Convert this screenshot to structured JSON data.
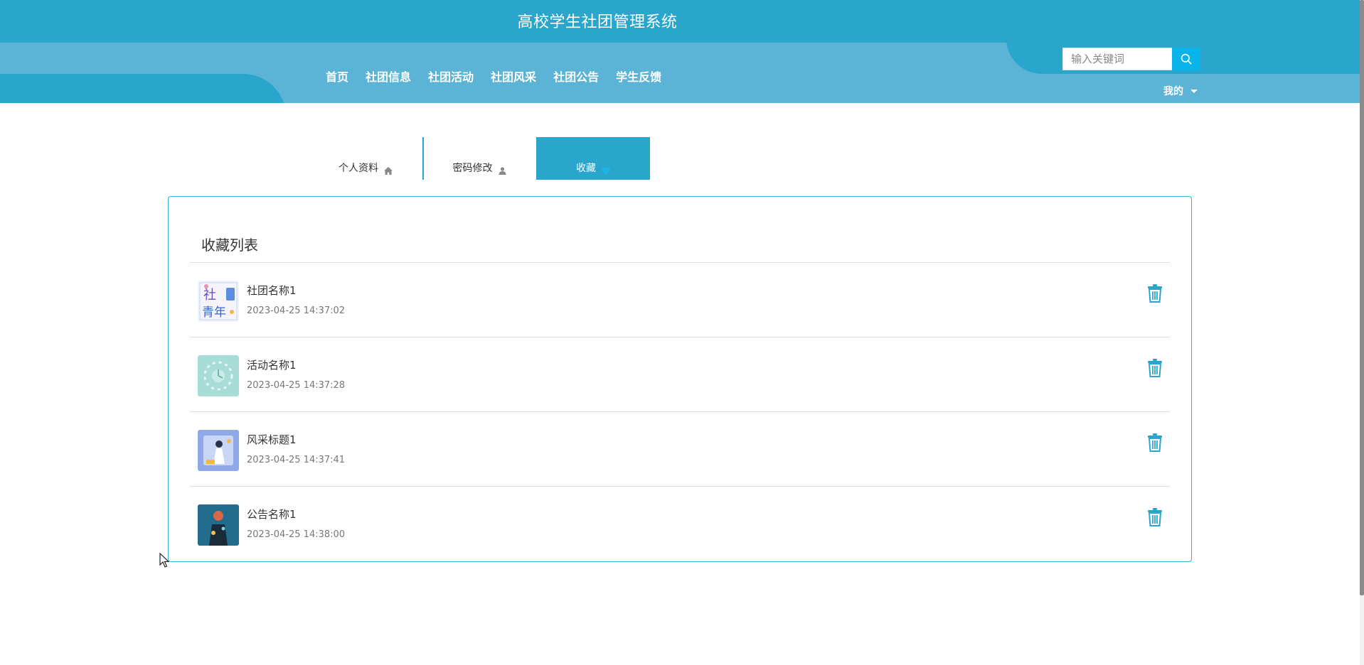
{
  "header": {
    "title": "高校学生社团管理系统",
    "nav": [
      "首页",
      "社团信息",
      "社团活动",
      "社团风采",
      "社团公告",
      "学生反馈"
    ],
    "search_placeholder": "输入关键词",
    "search_icon": "search-icon",
    "mine_label": "我的"
  },
  "tabs": [
    {
      "label": "个人资料",
      "icon": "home-icon"
    },
    {
      "label": "密码修改",
      "icon": "user-icon"
    },
    {
      "label": "收藏",
      "icon": "heart-icon",
      "active": true
    }
  ],
  "favorites": {
    "title": "收藏列表",
    "items": [
      {
        "name": "社团名称1",
        "time": "2023-04-25 14:37:02"
      },
      {
        "name": "活动名称1",
        "time": "2023-04-25 14:37:28"
      },
      {
        "name": "风采标题1",
        "time": "2023-04-25 14:37:41"
      },
      {
        "name": "公告名称1",
        "time": "2023-04-25 14:38:00"
      }
    ],
    "delete_icon": "trash-icon"
  },
  "colors": {
    "primary": "#2aa5cc",
    "nav_band": "#5bb4d6",
    "search_button": "#08b4ea",
    "panel_border": "#35b0d5"
  }
}
